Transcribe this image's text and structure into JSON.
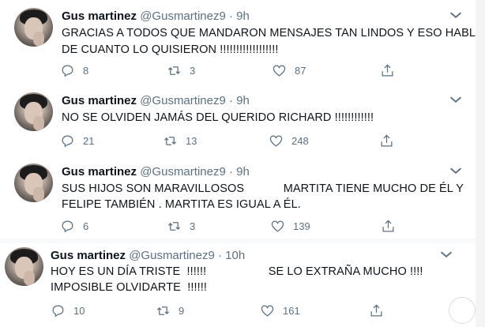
{
  "tweets": [
    {
      "name": "Gus martinez",
      "handle": "@Gusmartinez9",
      "dot": "·",
      "time": "9h",
      "text_lines": [
        "GRACIAS A TODOS QUE MANDARON MENSAJES TAN LINDOS Y ESO HABLA",
        "DE CUANTO LO QUISIERON !!!!!!!!!!!!!!!!!!"
      ],
      "replies": "8",
      "retweets": "3",
      "likes": "87"
    },
    {
      "name": "Gus martinez",
      "handle": "@Gusmartinez9",
      "dot": "·",
      "time": "9h",
      "text_lines": [
        "NO SE OLVIDEN JAMÁS DEL QUERIDO RICHARD !!!!!!!!!!!!",
        ""
      ],
      "replies": "21",
      "retweets": "13",
      "likes": "248"
    },
    {
      "name": "Gus martinez",
      "handle": "@Gusmartinez9",
      "dot": "·",
      "time": "9h",
      "text_lines": [
        "SUS HIJOS SON MARAVILLOSOS            MARTITA TIENE MUCHO DE ÉL Y",
        "FELIPE TAMBIÉN . MARTITA ES IGUAL A ÉL."
      ],
      "replies": "6",
      "retweets": "3",
      "likes": "139"
    },
    {
      "name": "Gus martinez",
      "handle": "@Gusmartinez9",
      "dot": "·",
      "time": "10h",
      "text_lines": [
        "HOY ES UN DÍA TRISTE  !!!!!!                   SE LO EXTRAÑA MUCHO !!!!",
        "IMPOSIBLE OLVIDARTE  !!!!!!"
      ],
      "replies": "10",
      "retweets": "9",
      "likes": "161"
    }
  ],
  "icons": {
    "reply": "reply-icon",
    "retweet": "retweet-icon",
    "like": "heart-icon",
    "share": "share-icon",
    "more": "chevron-down-icon"
  },
  "colors": {
    "secondary_text": "#5b7083",
    "divider": "#e6ecf0"
  }
}
